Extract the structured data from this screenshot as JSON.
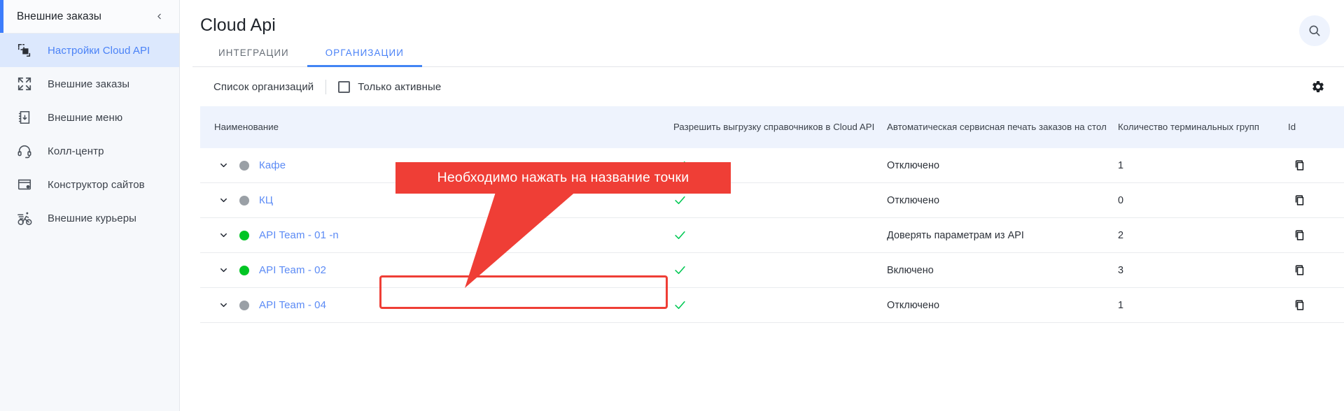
{
  "sidebar": {
    "header_title": "Внешние заказы",
    "collapse_icon": "chevron-left-icon",
    "items": [
      {
        "label": "Настройки Cloud API",
        "icon": "cloud-api-icon",
        "active": true
      },
      {
        "label": "Внешние заказы",
        "icon": "external-orders-icon",
        "active": false
      },
      {
        "label": "Внешние меню",
        "icon": "external-menu-icon",
        "active": false
      },
      {
        "label": "Колл-центр",
        "icon": "headset-icon",
        "active": false
      },
      {
        "label": "Конструктор сайтов",
        "icon": "site-builder-icon",
        "active": false
      },
      {
        "label": "Внешние курьеры",
        "icon": "bicycle-courier-icon",
        "active": false
      }
    ]
  },
  "header": {
    "title": "Cloud Api",
    "search_icon": "search-icon"
  },
  "tabs": [
    {
      "label": "ИНТЕГРАЦИИ",
      "active": false
    },
    {
      "label": "ОРГАНИЗАЦИИ",
      "active": true
    }
  ],
  "toolbar": {
    "list_label": "Список организаций",
    "only_active_label": "Только активные",
    "only_active_checked": false,
    "settings_icon": "gear-icon"
  },
  "table": {
    "columns": [
      "Наименование",
      "Разрешить выгрузку справочников в Cloud API",
      "Автоматическая сервисная печать заказов на стол",
      "Количество терминальных групп",
      "Id"
    ],
    "rows": [
      {
        "name": "Кафе",
        "status": "inactive",
        "allow_upload": true,
        "service_print": "Отключено",
        "terminal_groups": "1",
        "copy_icon": "copy-icon",
        "chevron": "chevron-down-icon"
      },
      {
        "name": "КЦ",
        "status": "inactive",
        "allow_upload": true,
        "service_print": "Отключено",
        "terminal_groups": "0",
        "copy_icon": "copy-icon",
        "chevron": "chevron-down-icon"
      },
      {
        "name": "API Team - 01 -n",
        "status": "active",
        "allow_upload": true,
        "service_print": "Доверять параметрам из API",
        "terminal_groups": "2",
        "copy_icon": "copy-icon",
        "chevron": "chevron-down-icon"
      },
      {
        "name": "API Team - 02",
        "status": "active",
        "allow_upload": true,
        "service_print": "Включено",
        "terminal_groups": "3",
        "copy_icon": "copy-icon",
        "chevron": "chevron-down-icon"
      },
      {
        "name": "API Team - 04",
        "status": "inactive",
        "allow_upload": true,
        "service_print": "Отключено",
        "terminal_groups": "1",
        "copy_icon": "copy-icon",
        "chevron": "chevron-down-icon"
      }
    ]
  },
  "annotation": {
    "callout_text": "Необходимо нажать на название точки",
    "accent_color": "#ef3e36",
    "highlight_target": "API Team - 01 -n"
  },
  "colors": {
    "brand_blue": "#4285f4",
    "link_blue": "#5c8bf5",
    "active_green": "#00c524",
    "check_green": "#00c853",
    "inactive_gray": "#9aa0a6",
    "header_bg": "#eef3fd",
    "sidebar_bg": "#f6f8fb"
  }
}
